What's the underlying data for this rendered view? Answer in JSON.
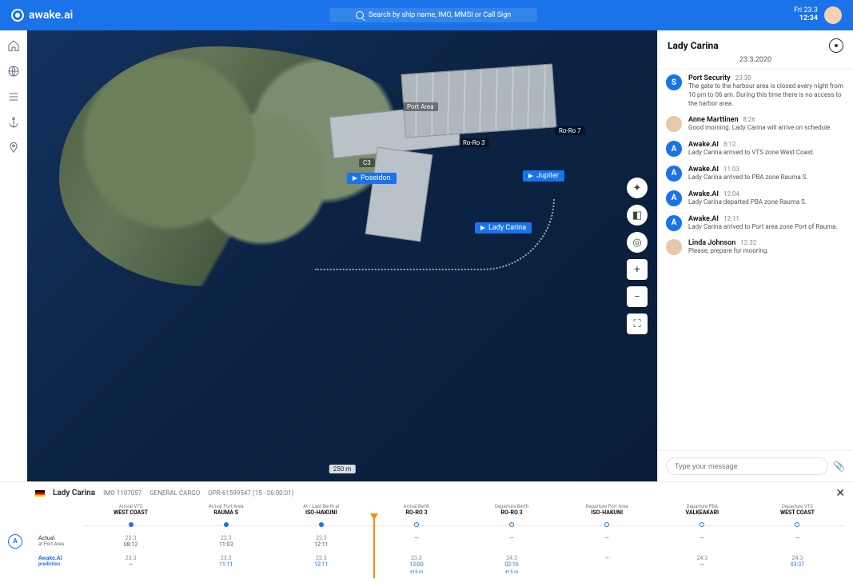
{
  "brand": "awake.ai",
  "search": {
    "placeholder": "Search by ship name, IMO, MMSI or Call Sign"
  },
  "clock": {
    "date": "Fri 23.3",
    "time": "12:34"
  },
  "map": {
    "vessels": [
      {
        "name": "Poseidon"
      },
      {
        "name": "Jupiter"
      },
      {
        "name": "Lady Carina"
      }
    ],
    "berths": [
      {
        "name": "Port Area"
      },
      {
        "name": "Ro-Ro 3"
      },
      {
        "name": "Ro-Ro 7"
      },
      {
        "name": "C3"
      }
    ],
    "scale": "250 m"
  },
  "panel": {
    "title": "Lady Carina",
    "date": "23.3.2020",
    "messages": [
      {
        "avatar": "S",
        "kind": "system",
        "name": "Port Security",
        "time": "23:30",
        "text": "The gate to the harbour area is closed every night from 10 pm to 06 am. During this time there is no access to the harbor area."
      },
      {
        "avatar": "",
        "kind": "person",
        "name": "Anne Marttinen",
        "time": "8:26",
        "text": "Good morning. Lady Carina will arrive on schedule."
      },
      {
        "avatar": "A",
        "kind": "ai",
        "name": "Awake.AI",
        "time": "8:12",
        "text": "Lady Carina arrived to VTS zone West Coast."
      },
      {
        "avatar": "A",
        "kind": "ai",
        "name": "Awake.AI",
        "time": "11:03",
        "text": "Lady Carina arrived to PBA zone Rauma S."
      },
      {
        "avatar": "A",
        "kind": "ai",
        "name": "Awake.AI",
        "time": "12:04",
        "text": "Lady Carina departed PBA zone Rauma S."
      },
      {
        "avatar": "A",
        "kind": "ai",
        "name": "Awake.AI",
        "time": "12:11",
        "text": "Lady Carina arrived to Port area zone Port of Rauma."
      },
      {
        "avatar": "",
        "kind": "person",
        "name": "Linda Johnson",
        "time": "12:32",
        "text": "Please, prepare for mooring."
      }
    ],
    "compose_placeholder": "Type your message"
  },
  "timeline": {
    "vessel_name": "Lady Carina",
    "imo": "IMO 1107057",
    "type": "GENERAL CARGO",
    "schedule_id": "OPR-61599547 (15 - 26:00:01)",
    "stages": [
      {
        "stage": "Arrival VTS",
        "port": "WEST COAST"
      },
      {
        "stage": "Arrival Port Area",
        "port": "RAUMA S"
      },
      {
        "stage": "At / Last Berth at",
        "port": "ISO-HAKUNI"
      },
      {
        "stage": "Arrival Berth",
        "port": "RO-RO 3"
      },
      {
        "stage": "Departure Berth",
        "port": "RO-RO 3"
      },
      {
        "stage": "Departure Port Area",
        "port": "ISO-HAKUNI"
      },
      {
        "stage": "Departure PBA",
        "port": "VALKEAKARI"
      },
      {
        "stage": "Departure VTS",
        "port": "WEST COAST"
      }
    ],
    "rows": [
      {
        "label": "Actual",
        "sub": "at Port Area",
        "values": [
          {
            "d": "23.3",
            "t": "08:12"
          },
          {
            "d": "23.3",
            "t": "11:03"
          },
          {
            "d": "23.3",
            "t": "12:11"
          },
          {
            "d": "",
            "t": "—"
          },
          {
            "d": "",
            "t": "—"
          },
          {
            "d": "",
            "t": "—"
          },
          {
            "d": "",
            "t": "—"
          },
          {
            "d": "",
            "t": "—"
          }
        ]
      },
      {
        "label": "Awake.AI",
        "sub": "prediction",
        "blue": true,
        "values": [
          {
            "d": "23.3",
            "t": "—"
          },
          {
            "d": "23.3",
            "t": "11:11"
          },
          {
            "d": "23.3",
            "t": "12:11"
          },
          {
            "d": "23.3",
            "t": "13:00",
            "extra": "±15 m"
          },
          {
            "d": "24.3",
            "t": "02:16",
            "extra": "±15 m"
          },
          {
            "d": "",
            "t": "—"
          },
          {
            "d": "24.3",
            "t": "—"
          },
          {
            "d": "24.3",
            "t": "03:37"
          }
        ]
      }
    ]
  }
}
